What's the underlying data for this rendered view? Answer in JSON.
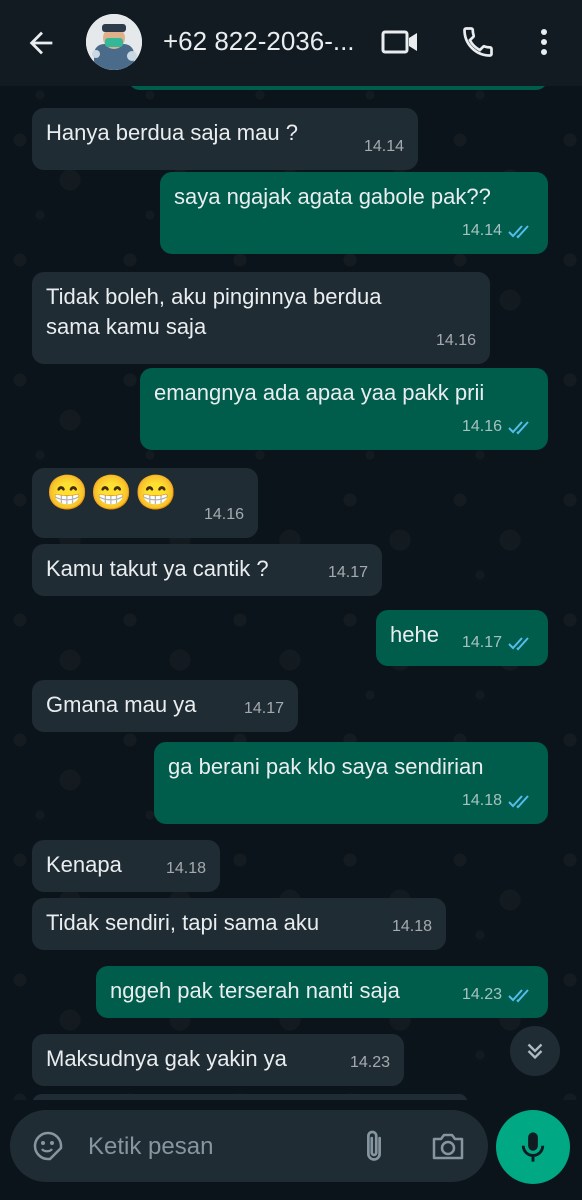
{
  "header": {
    "contact": "+62 822-2036-...",
    "icons": {
      "back": "arrow-left-icon",
      "video": "video-camera-icon",
      "call": "phone-icon",
      "menu": "kebab-menu-icon"
    }
  },
  "messages": [
    {
      "dir": "in",
      "text": "Hanya berdua saja mau ?",
      "time": "14.14"
    },
    {
      "dir": "out",
      "text": "saya ngajak agata gabole pak??",
      "time": "14.14",
      "ticks": true
    },
    {
      "dir": "in",
      "text": "Tidak boleh, aku pinginnya berdua\nsama kamu saja",
      "time": "14.16"
    },
    {
      "dir": "out",
      "text": "emangnya ada apaa yaa pakk prii",
      "time": "14.16",
      "ticks": true
    },
    {
      "dir": "in",
      "text": "😁😁😁",
      "time": "14.16",
      "emoji": true
    },
    {
      "dir": "in",
      "text": "Kamu takut ya cantik ?",
      "time": "14.17"
    },
    {
      "dir": "out",
      "text": "hehe",
      "time": "14.17",
      "ticks": true
    },
    {
      "dir": "in",
      "text": "Gmana mau ya",
      "time": "14.17"
    },
    {
      "dir": "out",
      "text": "ga berani pak klo saya sendirian",
      "time": "14.18",
      "ticks": true
    },
    {
      "dir": "in",
      "text": "Kenapa",
      "time": "14.18"
    },
    {
      "dir": "in",
      "text": "Tidak sendiri, tapi sama aku",
      "time": "14.18"
    },
    {
      "dir": "out",
      "text": "nggeh pak terserah nanti saja",
      "time": "14.23",
      "ticks": true
    },
    {
      "dir": "in",
      "text": "Maksudnya gak yakin ya",
      "time": "14.23"
    }
  ],
  "composer": {
    "placeholder": "Ketik pesan",
    "icons": {
      "sticker": "sticker-icon",
      "attach": "paperclip-icon",
      "camera": "camera-icon",
      "mic": "microphone-icon",
      "scroll": "double-chevron-down-icon"
    }
  },
  "colors": {
    "incoming": "#202c33",
    "outgoing": "#005c4b",
    "accent": "#00a884",
    "read_ticks": "#53bdeb"
  }
}
